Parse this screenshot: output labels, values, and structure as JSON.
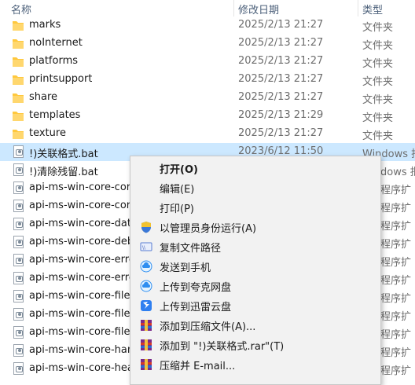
{
  "columns": {
    "name": "名称",
    "date": "修改日期",
    "type": "类型"
  },
  "files": [
    {
      "name": "marks",
      "date": "2025/2/13 21:27",
      "type": "文件夹",
      "kind": "folder"
    },
    {
      "name": "noInternet",
      "date": "2025/2/13 21:27",
      "type": "文件夹",
      "kind": "folder"
    },
    {
      "name": "platforms",
      "date": "2025/2/13 21:27",
      "type": "文件夹",
      "kind": "folder"
    },
    {
      "name": "printsupport",
      "date": "2025/2/13 21:27",
      "type": "文件夹",
      "kind": "folder"
    },
    {
      "name": "share",
      "date": "2025/2/13 21:27",
      "type": "文件夹",
      "kind": "folder"
    },
    {
      "name": "templates",
      "date": "2025/2/13 21:29",
      "type": "文件夹",
      "kind": "folder"
    },
    {
      "name": "texture",
      "date": "2025/2/13 21:27",
      "type": "文件夹",
      "kind": "folder"
    },
    {
      "name": "!)关联格式.bat",
      "date": "2023/6/12 11:50",
      "type": "Windows 批",
      "kind": "bat",
      "selected": true
    },
    {
      "name": "!)清除残留.bat",
      "date": "",
      "type": "dows 批",
      "kind": "bat"
    },
    {
      "name": "api-ms-win-core-cor",
      "date": "",
      "type": "程序扩",
      "kind": "dll"
    },
    {
      "name": "api-ms-win-core-cor",
      "date": "",
      "type": "程序扩",
      "kind": "dll"
    },
    {
      "name": "api-ms-win-core-dat",
      "date": "",
      "type": "程序扩",
      "kind": "dll"
    },
    {
      "name": "api-ms-win-core-deb",
      "date": "",
      "type": "程序扩",
      "kind": "dll"
    },
    {
      "name": "api-ms-win-core-erro",
      "date": "",
      "type": "程序扩",
      "kind": "dll"
    },
    {
      "name": "api-ms-win-core-erro",
      "date": "",
      "type": "程序扩",
      "kind": "dll"
    },
    {
      "name": "api-ms-win-core-file-",
      "date": "",
      "type": "程序扩",
      "kind": "dll"
    },
    {
      "name": "api-ms-win-core-file-",
      "date": "",
      "type": "程序扩",
      "kind": "dll"
    },
    {
      "name": "api-ms-win-core-file-",
      "date": "",
      "type": "程序扩",
      "kind": "dll"
    },
    {
      "name": "api-ms-win-core-han",
      "date": "",
      "type": "程序扩",
      "kind": "dll"
    },
    {
      "name": "api-ms-win-core-hea",
      "date": "",
      "type": "程序扩",
      "kind": "dll"
    }
  ],
  "context_menu": [
    {
      "label": "打开(O)",
      "bold": true,
      "icon": ""
    },
    {
      "label": "编辑(E)",
      "icon": ""
    },
    {
      "label": "打印(P)",
      "icon": ""
    },
    {
      "label": "以管理员身份运行(A)",
      "icon": "shield-icon"
    },
    {
      "label": "复制文件路径",
      "icon": "copy-path-icon"
    },
    {
      "label": "发送到手机",
      "icon": "cloud-phone-icon"
    },
    {
      "label": "上传到夸克网盘",
      "icon": "quark-cloud-icon"
    },
    {
      "label": "上传到迅雷云盘",
      "icon": "thunder-cloud-icon"
    },
    {
      "label": "添加到压缩文件(A)...",
      "icon": "winrar-icon"
    },
    {
      "label": "添加到 \"!)关联格式.rar\"(T)",
      "icon": "winrar-icon"
    },
    {
      "label": "压缩并 E-mail...",
      "icon": "winrar-icon"
    }
  ],
  "colors": {
    "selection": "#cce8ff",
    "folder": "#ffc83d",
    "menu_bg": "#f2f2f2"
  }
}
